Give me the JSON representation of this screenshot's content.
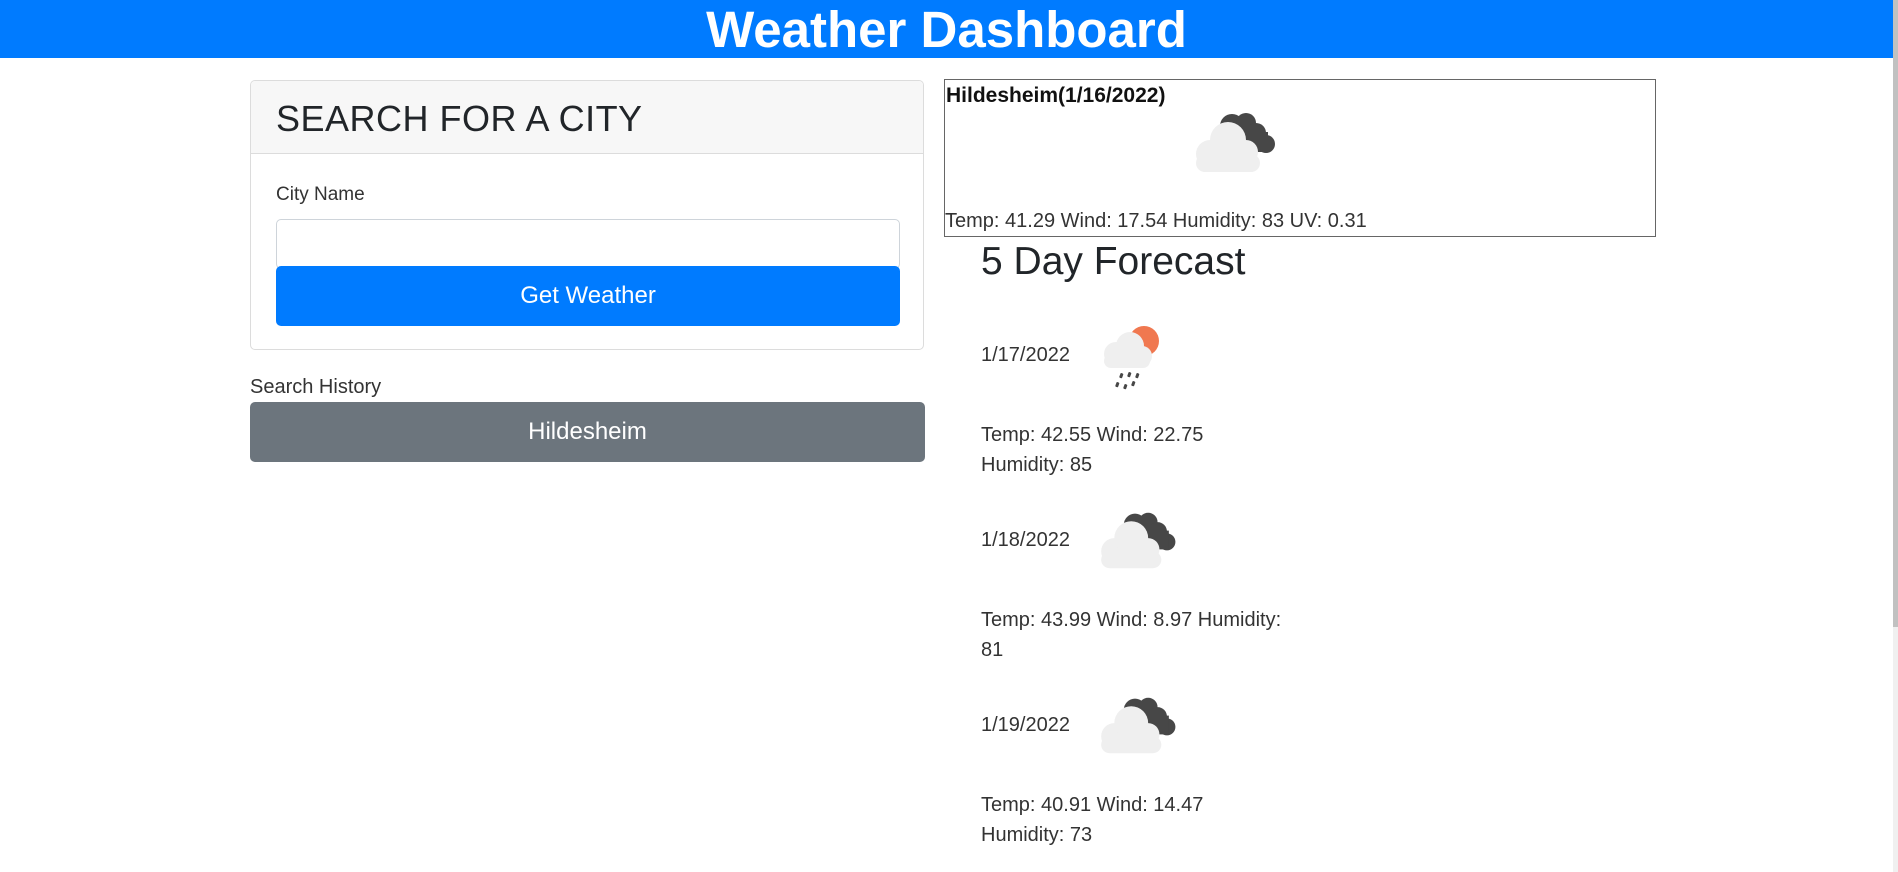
{
  "header": {
    "title": "Weather Dashboard"
  },
  "search": {
    "title": "SEARCH FOR A CITY",
    "label": "City Name",
    "input_value": "",
    "button_label": "Get Weather"
  },
  "history": {
    "label": "Search History",
    "items": [
      {
        "label": "Hildesheim"
      }
    ]
  },
  "current": {
    "title": "Hildesheim(1/16/2022)",
    "icon": "cloudy-night-icon",
    "stats": "Temp: 41.29 Wind: 17.54 Humidity: 83 UV: 0.31"
  },
  "forecast": {
    "heading": "5 Day Forecast",
    "days": [
      {
        "date": "1/17/2022",
        "icon": "rain-sun-icon",
        "stats": "Temp: 42.55 Wind: 22.75 Humidity: 85"
      },
      {
        "date": "1/18/2022",
        "icon": "cloudy-night-icon",
        "stats": "Temp: 43.99 Wind: 8.97 Humidity: 81"
      },
      {
        "date": "1/19/2022",
        "icon": "cloudy-night-icon",
        "stats": "Temp: 40.91 Wind: 14.47 Humidity: 73"
      }
    ]
  },
  "colors": {
    "primary": "#007bff",
    "secondary": "#6c757d",
    "sun": "#f07850",
    "dark_cloud": "#474747",
    "light_cloud": "#efefef"
  }
}
